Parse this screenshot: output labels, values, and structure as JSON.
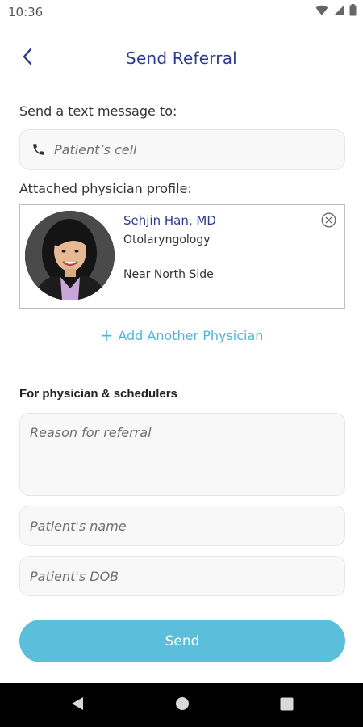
{
  "status_bar": {
    "time": "10:36"
  },
  "header": {
    "title": "Send Referral"
  },
  "text_message": {
    "label": "Send a text message to:",
    "cell_placeholder": "Patient’s cell"
  },
  "attached": {
    "label": "Attached physician profile:",
    "physician": {
      "name": "Sehjin Han, MD",
      "specialty": "Otolaryngology",
      "location": "Near North Side"
    }
  },
  "add_physician": {
    "plus": "+",
    "label": "Add Another Physician"
  },
  "scheduler_section": {
    "title": "For physician & schedulers",
    "reason_placeholder": "Reason for referral",
    "name_placeholder": "Patient's name",
    "dob_placeholder": "Patient's DOB"
  },
  "send_button": {
    "label": "Send"
  },
  "icons": {
    "back": "chevron-left-icon",
    "phone": "phone-icon",
    "remove": "close-circle-icon",
    "wifi": "wifi-icon",
    "signal": "signal-icon",
    "battery": "battery-icon",
    "nav_back": "triangle-back-icon",
    "nav_home": "circle-home-icon",
    "nav_recents": "square-recents-icon"
  },
  "colors": {
    "title": "#2f3a8f",
    "accent": "#4bb8d4",
    "button": "#5bbfdc"
  }
}
